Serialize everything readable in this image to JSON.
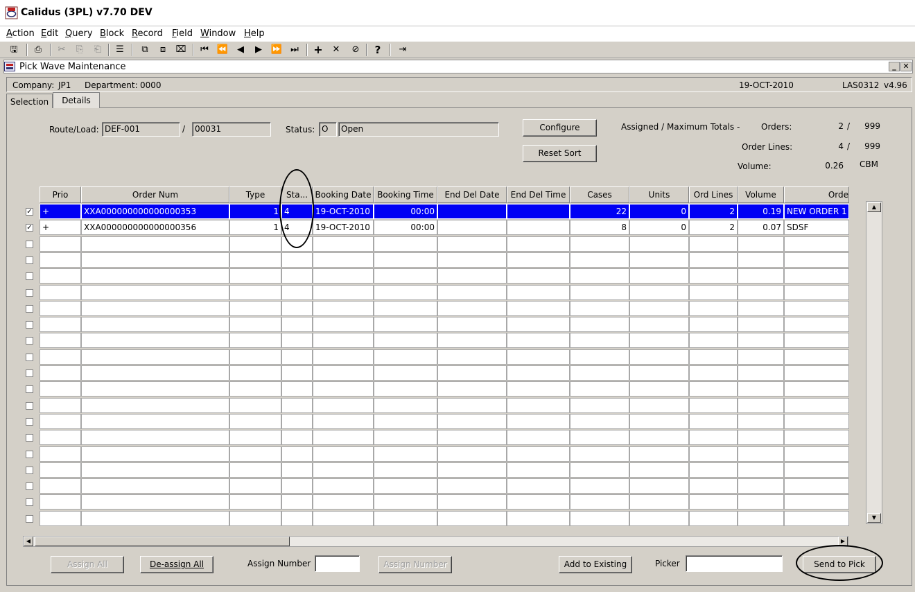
{
  "window": {
    "title": "Calidus (3PL) v7.70 DEV"
  },
  "menu": [
    {
      "label": "Action",
      "key": "A",
      "rest": "ction"
    },
    {
      "label": "Edit",
      "key": "E",
      "rest": "dit"
    },
    {
      "label": "Query",
      "key": "Q",
      "rest": "uery"
    },
    {
      "label": "Block",
      "key": "B",
      "rest": "lock"
    },
    {
      "label": "Record",
      "key": "R",
      "rest": "ecord"
    },
    {
      "label": "Field",
      "key": "F",
      "rest": "ield"
    },
    {
      "label": "Window",
      "key": "W",
      "rest": "indow"
    },
    {
      "label": "Help",
      "key": "H",
      "rest": "elp"
    }
  ],
  "toolbar_icons": [
    "save-icon",
    "print-icon",
    "cut-icon",
    "copy-icon",
    "paste-icon",
    "list-icon",
    "query-enter-icon",
    "query-execute-icon",
    "query-cancel-icon",
    "first-record-icon",
    "previous-block-icon",
    "previous-record-icon",
    "next-record-icon",
    "next-block-icon",
    "last-record-icon",
    "insert-record-icon",
    "delete-record-icon",
    "clear-record-icon",
    "help-icon",
    "exit-icon"
  ],
  "form": {
    "title": "Pick Wave Maintenance",
    "company_label": "Company:",
    "company": "JP1",
    "department_label": "Department:",
    "department": "0000",
    "date": "19-OCT-2010",
    "module": "LAS0312",
    "version": "v4.96"
  },
  "tabs": [
    {
      "label": "Selection"
    },
    {
      "label": "Details"
    }
  ],
  "details": {
    "route_label": "Route/Load:",
    "route": "DEF-001",
    "separator": "/",
    "load": "00031",
    "status_label": "Status:",
    "status_code": "O",
    "status_text": "Open",
    "configure_label": "Configure",
    "reset_sort_label": "Reset Sort",
    "totals_title": "Assigned / Maximum Totals -",
    "orders_label": "Orders:",
    "orders_assigned": "2",
    "orders_max": "999",
    "lines_label": "Order Lines:",
    "lines_assigned": "4",
    "lines_max": "999",
    "volume_label": "Volume:",
    "volume": "0.26",
    "volume_unit": "CBM",
    "slash": "/"
  },
  "grid": {
    "headers": [
      "Prio",
      "Order Num",
      "Type",
      "Sta...",
      "Booking Date",
      "Booking Time",
      "End Del Date",
      "End Del Time",
      "Cases",
      "Units",
      "Ord Lines",
      "Volume",
      "Orde"
    ],
    "rows": [
      {
        "checked": true,
        "prio": "+",
        "order_num": "XXA000000000000000353",
        "type": "1",
        "status": "4",
        "booking_date": "19-OCT-2010",
        "booking_time": "00:00",
        "end_del_date": "",
        "end_del_time": "",
        "cases": "22",
        "units": "0",
        "ord_lines": "2",
        "volume": "0.19",
        "order_ref": "NEW ORDER 1"
      },
      {
        "checked": true,
        "prio": "+",
        "order_num": "XXA000000000000000356",
        "type": "1",
        "status": "4",
        "booking_date": "19-OCT-2010",
        "booking_time": "00:00",
        "end_del_date": "",
        "end_del_time": "",
        "cases": "8",
        "units": "0",
        "ord_lines": "2",
        "volume": "0.07",
        "order_ref": "SDSF"
      }
    ]
  },
  "bottom": {
    "assign_all_label": "Assign All",
    "deassign_all_label": "De-assign All",
    "assign_number_label": "Assign Number",
    "assign_number_value": "",
    "assign_number_button": "Assign Number",
    "add_existing_label": "Add to Existing",
    "picker_label": "Picker",
    "picker_value": "",
    "send_to_pick_label": "Send to Pick"
  }
}
